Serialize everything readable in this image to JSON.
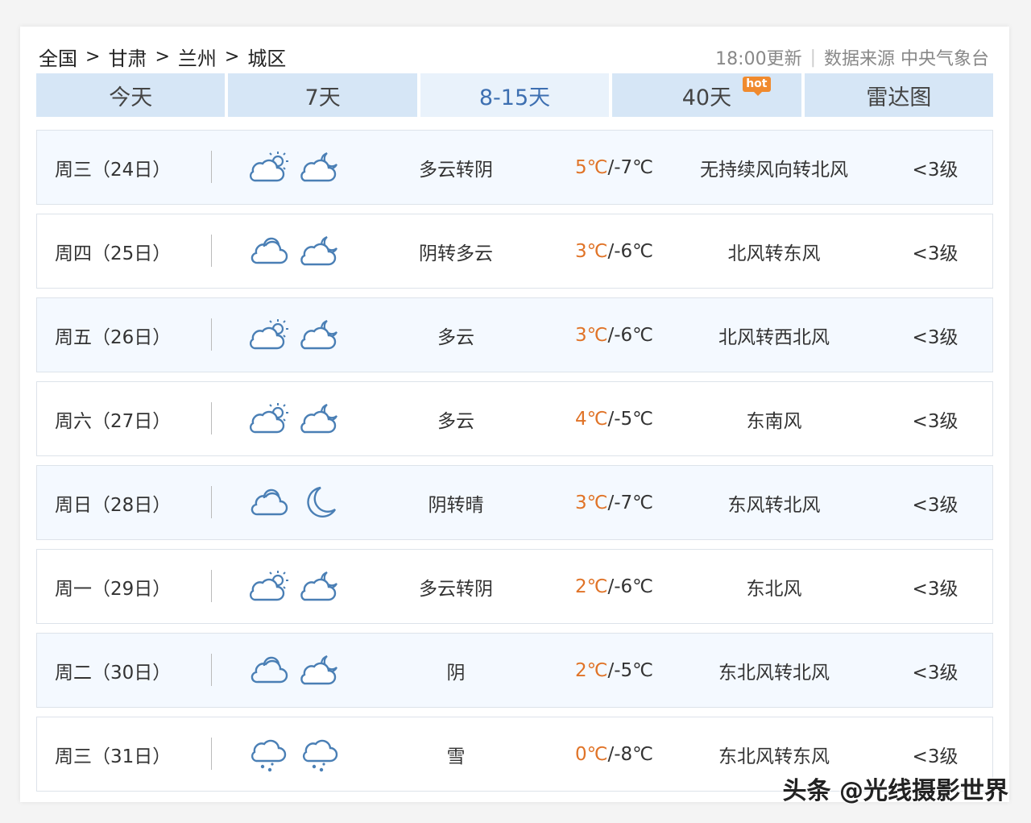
{
  "breadcrumb": [
    "全国",
    "甘肃",
    "兰州",
    "城区"
  ],
  "breadcrumb_sep": ">",
  "update_time": "18:00更新",
  "meta_sep": "|",
  "source": "数据来源 中央气象台",
  "tabs": [
    {
      "label": "今天",
      "active": false
    },
    {
      "label": "7天",
      "active": false
    },
    {
      "label": "8-15天",
      "active": true
    },
    {
      "label": "40天",
      "active": false,
      "badge": "hot"
    },
    {
      "label": "雷达图",
      "active": false
    }
  ],
  "forecast": [
    {
      "day": "周三（24日）",
      "icon_day": "partly-cloudy-day-icon",
      "icon_night": "partly-cloudy-night-icon",
      "desc": "多云转阴",
      "high": "5℃",
      "low": "/-7℃",
      "wind": "无持续风向转北风",
      "level": "<3级"
    },
    {
      "day": "周四（25日）",
      "icon_day": "cloudy-icon",
      "icon_night": "partly-cloudy-night-icon",
      "desc": "阴转多云",
      "high": "3℃",
      "low": "/-6℃",
      "wind": "北风转东风",
      "level": "<3级"
    },
    {
      "day": "周五（26日）",
      "icon_day": "partly-cloudy-day-icon",
      "icon_night": "partly-cloudy-night-icon",
      "desc": "多云",
      "high": "3℃",
      "low": "/-6℃",
      "wind": "北风转西北风",
      "level": "<3级"
    },
    {
      "day": "周六（27日）",
      "icon_day": "partly-cloudy-day-icon",
      "icon_night": "partly-cloudy-night-icon",
      "desc": "多云",
      "high": "4℃",
      "low": "/-5℃",
      "wind": "东南风",
      "level": "<3级"
    },
    {
      "day": "周日（28日）",
      "icon_day": "cloudy-icon",
      "icon_night": "moon-icon",
      "desc": "阴转晴",
      "high": "3℃",
      "low": "/-7℃",
      "wind": "东风转北风",
      "level": "<3级"
    },
    {
      "day": "周一（29日）",
      "icon_day": "partly-cloudy-day-icon",
      "icon_night": "partly-cloudy-night-icon",
      "desc": "多云转阴",
      "high": "2℃",
      "low": "/-6℃",
      "wind": "东北风",
      "level": "<3级"
    },
    {
      "day": "周二（30日）",
      "icon_day": "cloudy-icon",
      "icon_night": "partly-cloudy-night-icon",
      "desc": "阴",
      "high": "2℃",
      "low": "/-5℃",
      "wind": "东北风转北风",
      "level": "<3级"
    },
    {
      "day": "周三（31日）",
      "icon_day": "snow-icon",
      "icon_night": "snow-icon",
      "desc": "雪",
      "high": "0℃",
      "low": "/-8℃",
      "wind": "东北风转东风",
      "level": "<3级"
    }
  ],
  "watermark": "头条 @光线摄影世界",
  "colors": {
    "high_temp": "#e07327",
    "tab_bg": "#d6e6f6",
    "tab_active_text": "#3d6fb1",
    "icon_stroke": "#4a7fb5"
  }
}
